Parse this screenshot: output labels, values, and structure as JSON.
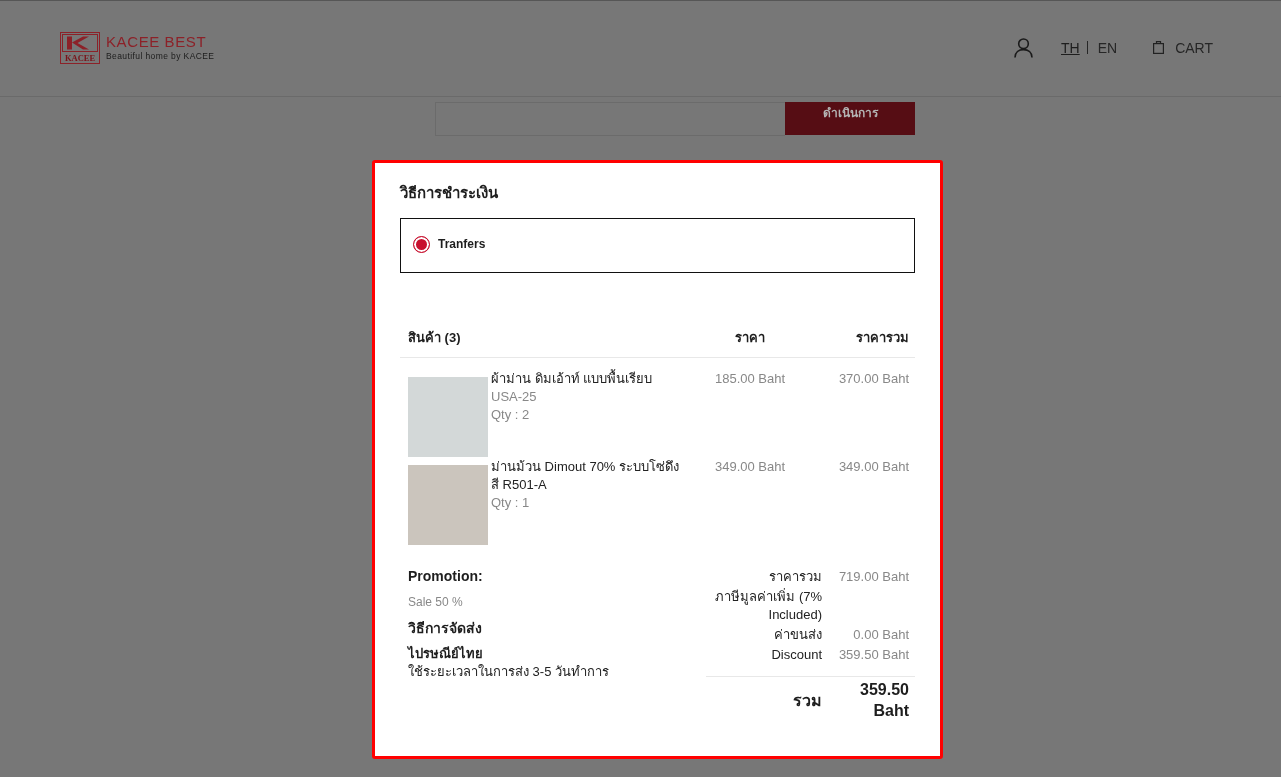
{
  "header": {
    "logo": {
      "mark_text": "KACEE",
      "title": "KACEE BEST",
      "tagline": "Beautiful home by KACEE"
    },
    "languages": [
      {
        "label": "TH",
        "selected": true
      },
      {
        "label": "EN",
        "selected": false
      }
    ],
    "cart": {
      "label": "CART"
    }
  },
  "background_form": {
    "button": "ดำเนินการ"
  },
  "payment_modal": {
    "title": "วิธีการชำระเงิน",
    "methods": [
      {
        "label": "Tranfers",
        "selected": true
      }
    ],
    "table": {
      "columns": [
        "สินค้า (3)",
        "ราคา",
        "ราคารวม"
      ],
      "rows": [
        {
          "name": "ผ้าม่าน ดิมเอ้าท์ แบบพื้นเรียบ",
          "variant": "USA-25",
          "qty": "Qty : 2",
          "price": "185.00 Baht",
          "total": "370.00 Baht"
        },
        {
          "name": "ม่านม้วน Dimout 70% ระบบโซ่ดึง สี R501-A",
          "qty": "Qty : 1",
          "price": "349.00 Baht",
          "total": "349.00 Baht"
        }
      ]
    },
    "promotion": {
      "label": "Promotion:",
      "value": "Sale 50 %"
    },
    "shipping": {
      "title": "วิธีการจัดส่ง",
      "carrier": "ไปรษณีย์ไทย",
      "note": "ใช้ระยะเวลาในการส่ง 3-5 วันทำการ"
    },
    "summary": {
      "lines": [
        {
          "label": "ราคารวม",
          "value": "719.00 Baht"
        },
        {
          "label": "ภาษีมูลค่าเพิ่ม (7% Included)"
        },
        {
          "label": "ค่าขนส่ง",
          "value": "0.00 Baht"
        },
        {
          "label": "Discount",
          "value": "359.50 Baht"
        }
      ],
      "total": {
        "label": "รวม",
        "value": "359.50 Baht"
      }
    }
  }
}
